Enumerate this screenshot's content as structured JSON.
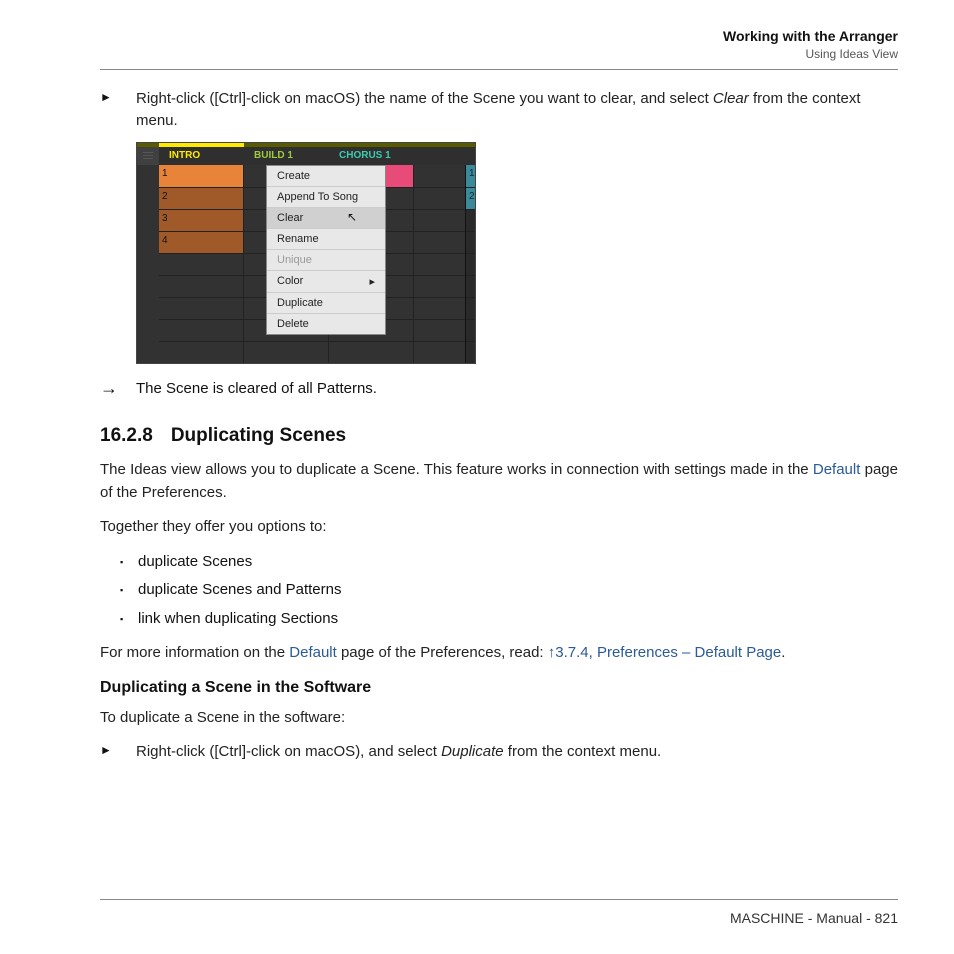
{
  "header": {
    "title": "Working with the Arranger",
    "sub": "Using Ideas View"
  },
  "step1": {
    "pre": "Right-click ([Ctrl]-click on macOS) the name of the Scene you want to clear, and select ",
    "em": "Clear",
    "post": " from the context menu."
  },
  "screenshot": {
    "scenes": {
      "intro": "INTRO",
      "build": "BUILD 1",
      "chorus": "CHORUS 1"
    },
    "rows": [
      "1",
      "2",
      "3",
      "4"
    ],
    "rightcol": [
      "1",
      "2"
    ],
    "menu": {
      "create": "Create",
      "append": "Append To Song",
      "clear": "Clear",
      "rename": "Rename",
      "unique": "Unique",
      "color": "Color",
      "duplicate": "Duplicate",
      "delete": "Delete"
    }
  },
  "result1": "The Scene is cleared of all Patterns.",
  "section": {
    "num": "16.2.8",
    "title": "Duplicating Scenes"
  },
  "p1a": "The Ideas view allows you to duplicate a Scene. This feature works in connection with settings made in the ",
  "p1link": "Default",
  "p1b": " page of the Preferences.",
  "p2": "Together they offer you options to:",
  "bullets": [
    "duplicate Scenes",
    "duplicate Scenes and Patterns",
    "link when duplicating Sections"
  ],
  "p3a": "For more information on the ",
  "p3link1": "Default",
  "p3b": " page of the Preferences, read: ",
  "p3link2": "↑3.7.4, Preferences – Default Page",
  "p3c": ".",
  "h3": "Duplicating a Scene in the Software",
  "p4": "To duplicate a Scene in the software:",
  "step2": {
    "pre": "Right-click ([Ctrl]-click on macOS), and select ",
    "em": "Duplicate",
    "post": " from the context menu."
  },
  "footer": "MASCHINE - Manual - 821"
}
